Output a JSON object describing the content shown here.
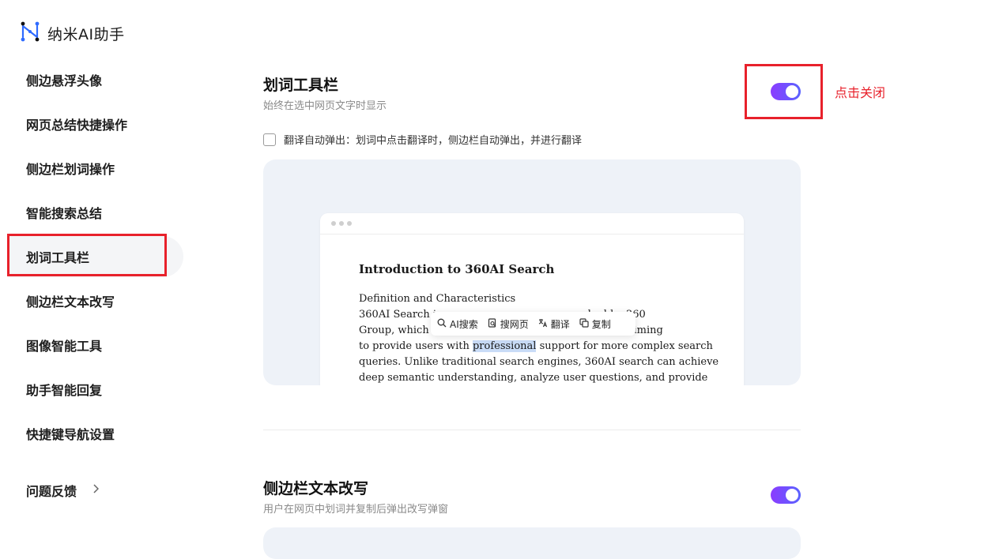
{
  "app": {
    "name": "纳米AI助手",
    "logo_icon": "nami-logo-icon",
    "brand_color": "#2f6bff"
  },
  "sidebar": {
    "items": [
      {
        "label": "侧边悬浮头像"
      },
      {
        "label": "网页总结快捷操作"
      },
      {
        "label": "侧边栏划词操作"
      },
      {
        "label": "智能搜索总结"
      },
      {
        "label": "划词工具栏",
        "active": true
      },
      {
        "label": "侧边栏文本改写"
      },
      {
        "label": "图像智能工具"
      },
      {
        "label": "助手智能回复"
      },
      {
        "label": "快捷键导航设置"
      }
    ],
    "feedback": {
      "label": "问题反馈",
      "icon": "chevron-right-icon"
    }
  },
  "sections": [
    {
      "title": "划词工具栏",
      "subtitle": "始终在选中网页文字时显示",
      "enabled": true,
      "option": {
        "checked": false,
        "label": "翻译自动弹出：划词中点击翻译时，侧边栏自动弹出，并进行翻译"
      },
      "preview": {
        "doc_title": "Introduction to 360AI Search",
        "lines": [
          "Definition and Characteristics",
          "360AI Search is                                           ched by 360",
          "Group, which c                                              Model, aiming",
          "to provide users with ",
          "queries. Unlike traditional search engines, 360AI search can achieve",
          "deep semantic understanding, analyze user questions, and provide"
        ],
        "highlight_word": "professional",
        "line4_after": " support for more complex search",
        "toolbar": [
          {
            "label": "AI搜索",
            "icon": "search-icon"
          },
          {
            "label": "搜网页",
            "icon": "web-search-icon"
          },
          {
            "label": "翻译",
            "icon": "translate-icon"
          },
          {
            "label": "复制",
            "icon": "copy-icon"
          }
        ]
      }
    },
    {
      "title": "侧边栏文本改写",
      "subtitle": "用户在网页中划词并复制后弹出改写弹窗",
      "enabled": true
    }
  ],
  "annotation": {
    "text": "点击关闭",
    "color": "#e8212b"
  },
  "colors": {
    "toggle_gradient_start": "#8b3cff",
    "toggle_gradient_end": "#5a63ff",
    "highlight": "#c9dcf7"
  }
}
